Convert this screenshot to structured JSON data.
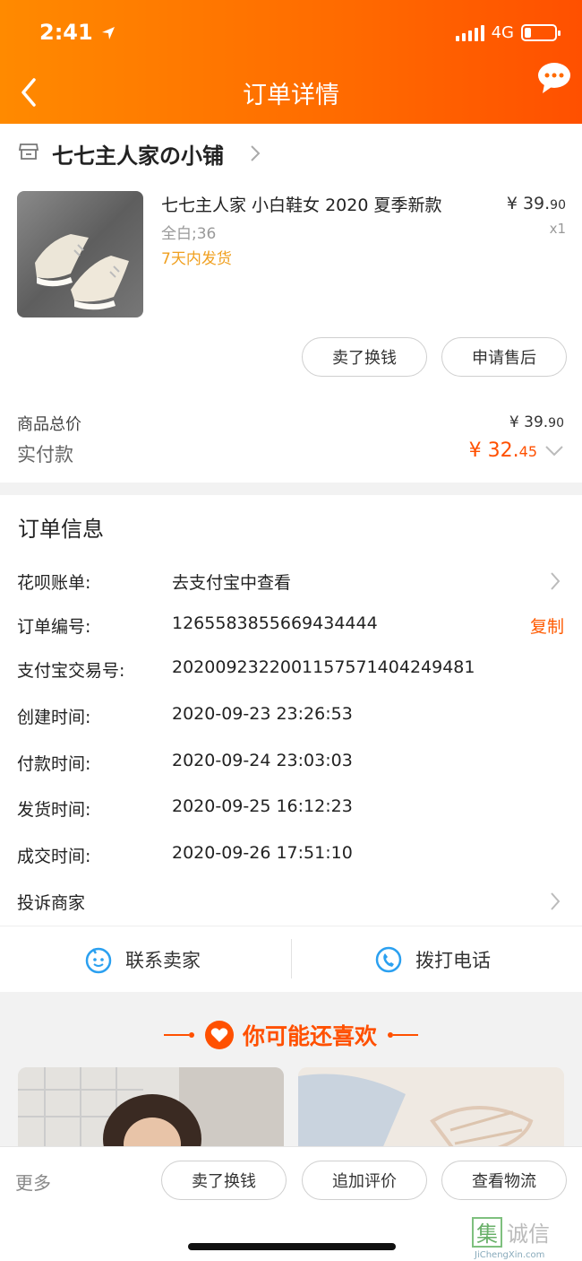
{
  "status_bar": {
    "time": "2:41",
    "network": "4G"
  },
  "header": {
    "title": "订单详情"
  },
  "shop": {
    "name": "七七主人家の小铺"
  },
  "product": {
    "title": "七七主人家 小白鞋女 2020 夏季新款",
    "spec": "全白;36",
    "shipping": "7天内发货",
    "price_main": "¥ 39.",
    "price_decimal": "90",
    "quantity": "x1"
  },
  "product_actions": [
    "卖了换钱",
    "申请售后"
  ],
  "summary": {
    "total_label": "商品总价",
    "total_main": "¥ 39.",
    "total_decimal": "90",
    "paid_label": "实付款",
    "paid_main": "¥ 32.",
    "paid_decimal": "45"
  },
  "order_info": {
    "title": "订单信息",
    "rows": [
      {
        "label": "花呗账单:",
        "value": "去支付宝中查看"
      },
      {
        "label": "订单编号:",
        "value": "1265583855669434444"
      },
      {
        "label": "支付宝交易号:",
        "value": "2020092322001157571404249481"
      },
      {
        "label": "创建时间:",
        "value": "2020-09-23 23:26:53"
      },
      {
        "label": "付款时间:",
        "value": "2020-09-24 23:03:03"
      },
      {
        "label": "发货时间:",
        "value": "2020-09-25 16:12:23"
      },
      {
        "label": "成交时间:",
        "value": "2020-09-26 17:51:10"
      }
    ],
    "copy_label": "复制",
    "complain_label": "投诉商家"
  },
  "contact": {
    "seller": "联系卖家",
    "phone": "拨打电话"
  },
  "recommend": {
    "title": "你可能还喜欢"
  },
  "bottom_bar": {
    "more": "更多",
    "buttons": [
      "卖了换钱",
      "追加评价",
      "查看物流"
    ]
  },
  "watermark": {
    "text": "集诚信",
    "sub": "JiChengXin.com"
  },
  "colors": {
    "accent": "#ff5000",
    "header_start": "#ff8a00",
    "shipping": "#f0a020"
  },
  "icons": [
    "back-icon",
    "chat-bubble-icon",
    "shop-icon",
    "chevron-right-icon",
    "chevron-down-icon",
    "smile-icon",
    "phone-icon",
    "heart-icon"
  ]
}
